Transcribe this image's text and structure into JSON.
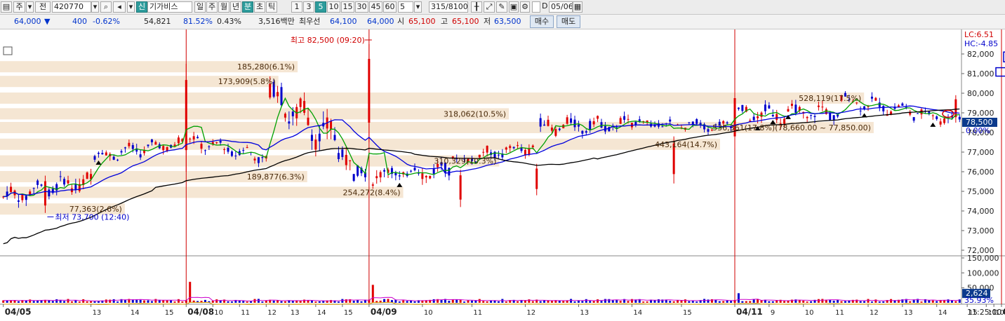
{
  "toolbar": {
    "code": "420770",
    "prefix": "주",
    "prefix2": "전",
    "name": "기가비스",
    "badge": "신",
    "periods": [
      "일",
      "주",
      "월",
      "년",
      "분",
      "초",
      "틱"
    ],
    "active_period": "분",
    "intervals": [
      "1",
      "3",
      "5",
      "10",
      "15",
      "30",
      "45",
      "60"
    ],
    "active_interval": "5",
    "count": "5",
    "counter": "315/8100",
    "date": "05/06",
    "check_label": "D"
  },
  "quote": {
    "price": "64,000",
    "change": "400",
    "change_pct": "-0.62%",
    "volume": "54,821",
    "vol_ratio": "81.52%",
    "turnover": "0.43%",
    "amount": "3,516백만",
    "best_label": "최우선",
    "ask": "64,100",
    "bid": "64,000",
    "open_label": "시",
    "open": "65,100",
    "high_label": "고",
    "high": "65,100",
    "low_label": "저",
    "low": "63,500",
    "buy_label": "매수",
    "sell_label": "매도"
  },
  "colors": {
    "up": "#e00000",
    "down": "#0000cc",
    "ma5": "#00a000",
    "ma20": "#0000dd",
    "ma60": "#000000",
    "band": "#f5e6d3",
    "vline": "#d00000"
  },
  "chart_data": {
    "type": "candlestick",
    "price_axis": {
      "min": 72000,
      "max": 82000,
      "ticks": [
        "82,000",
        "81,000",
        "80,000",
        "79,000",
        "78,000",
        "77,000",
        "76,000",
        "75,000",
        "74,000",
        "73,000",
        "72,000"
      ]
    },
    "volume_axis": {
      "ticks": [
        "150,000",
        "100,000",
        "50,000"
      ]
    },
    "axis_badges": {
      "lc": "LC:6.51",
      "hc": "HC:-4.85",
      "last_price": "78,500",
      "pct": "0.00%",
      "vol_value": "2,624",
      "vol_pct": "35.93%"
    },
    "x_labels": [
      {
        "t": "04/05",
        "major": true
      },
      {
        "t": "13",
        "major": false
      },
      {
        "t": "14",
        "major": false
      },
      {
        "t": "15",
        "major": false
      },
      {
        "t": "04/08",
        "major": true
      },
      {
        "t": "10",
        "major": false
      },
      {
        "t": "11",
        "major": false
      },
      {
        "t": "12",
        "major": false
      },
      {
        "t": "13",
        "major": false
      },
      {
        "t": "14",
        "major": false
      },
      {
        "t": "15",
        "major": false
      },
      {
        "t": "04/09",
        "major": true
      },
      {
        "t": "10",
        "major": false
      },
      {
        "t": "11",
        "major": false
      },
      {
        "t": "12",
        "major": false
      },
      {
        "t": "13",
        "major": false
      },
      {
        "t": "14",
        "major": false
      },
      {
        "t": "15",
        "major": false
      },
      {
        "t": "04/11",
        "major": true
      },
      {
        "t": "9",
        "major": false
      },
      {
        "t": "10",
        "major": false
      },
      {
        "t": "11",
        "major": false
      },
      {
        "t": "12",
        "major": false
      },
      {
        "t": "13",
        "major": false
      },
      {
        "t": "14",
        "major": false
      },
      {
        "t": "15",
        "major": false
      },
      {
        "t": "04/12",
        "major": true
      },
      {
        "t": "10",
        "major": false
      },
      {
        "t": "11",
        "major": false
      }
    ],
    "time_label": "11:25:00",
    "annotations": {
      "high": "최고 82,500 (09:20)",
      "low": "최저 73,700 (12:40)"
    },
    "volume_profile": [
      {
        "label": "185,280(6.1%)",
        "price": 81350,
        "frac": 0.31
      },
      {
        "label": "173,909(5.8%)",
        "price": 80600,
        "frac": 0.29
      },
      {
        "label": "528,119(17.5%)",
        "price": 79750,
        "frac": 0.9
      },
      {
        "label": "318,062(10.5%)",
        "price": 78950,
        "frac": 0.53
      },
      {
        "label": "536,361(17.8%)(78,660.00 ~ 77,850.00)",
        "price": 78250,
        "frac": 0.91
      },
      {
        "label": "443,164(14.7%)",
        "price": 77400,
        "frac": 0.75
      },
      {
        "label": "310,329(10.3%)",
        "price": 76550,
        "frac": 0.52
      },
      {
        "label": "189,877(6.3%)",
        "price": 75750,
        "frac": 0.32
      },
      {
        "label": "254,272(8.4%)",
        "price": 74950,
        "frac": 0.42
      },
      {
        "label": "77,363(2.6%)",
        "price": 74100,
        "frac": 0.13
      }
    ],
    "segments": [
      {
        "n": 24,
        "start": 74700,
        "end": 75600,
        "swing": 900
      },
      {
        "n": 24,
        "start": 76800,
        "end": 77500,
        "swing": 700
      },
      {
        "n": 22,
        "start": 77600,
        "end": 76700,
        "swing": 700
      },
      {
        "n": 22,
        "start": 80000,
        "end": 76800,
        "swing": 1800
      },
      {
        "n": 26,
        "start": 75800,
        "end": 76100,
        "swing": 900
      },
      {
        "n": 22,
        "start": 76600,
        "end": 77300,
        "swing": 700
      },
      {
        "n": 26,
        "start": 78300,
        "end": 78400,
        "swing": 800
      },
      {
        "n": 26,
        "start": 78500,
        "end": 78300,
        "swing": 500
      },
      {
        "n": 28,
        "start": 78900,
        "end": 79000,
        "swing": 900
      },
      {
        "n": 32,
        "start": 79700,
        "end": 78600,
        "swing": 700
      }
    ],
    "events": [
      {
        "i": 11,
        "high": 75800,
        "low": 73900
      },
      {
        "i": 48,
        "high": 81500,
        "low": 76000
      },
      {
        "i": 96,
        "high": 82500,
        "low": 77500
      },
      {
        "i": 120,
        "high": 76100,
        "low": 74200
      },
      {
        "i": 140,
        "high": 76400,
        "low": 74800
      },
      {
        "i": 176,
        "high": 77800,
        "low": 75400
      },
      {
        "i": 192,
        "high": 80200,
        "low": 77200
      },
      {
        "i": 250,
        "high": 79900,
        "low": 78500
      },
      {
        "i": 262,
        "high": 82100,
        "low": 78200
      }
    ],
    "vol_spikes": [
      {
        "i": 49,
        "v": 70000
      },
      {
        "i": 97,
        "v": 60000
      },
      {
        "i": 193,
        "v": 32000
      },
      {
        "i": 263,
        "v": 40000
      }
    ]
  }
}
